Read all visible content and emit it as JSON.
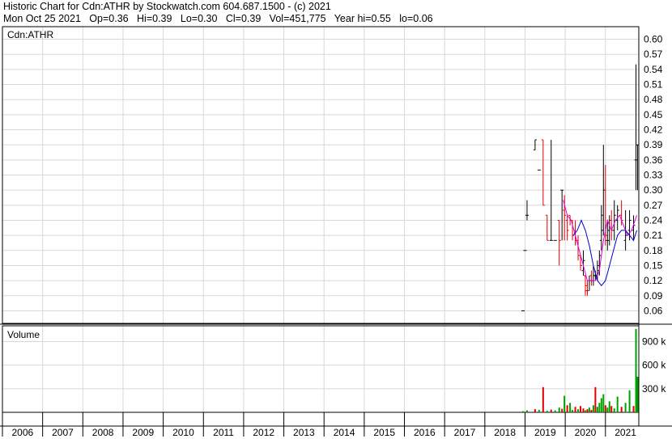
{
  "header": {
    "line1": "Historic Chart for Cdn:ATHR by Stockwatch.com 604.687.1500 - (c) 2021",
    "line2": "Mon Oct 25 2021   Op=0.36   Hi=0.39   Lo=0.30   Cl=0.39   Vol=451,775   Year hi=0.55   lo=0.06"
  },
  "price_panel": {
    "label": "Cdn:ATHR"
  },
  "volume_panel": {
    "label": "Volume"
  },
  "colors": {
    "grid": "#d8d8d8",
    "frame": "#000000",
    "up": "#000000",
    "down": "#e00000",
    "ma_short": "#e000e0",
    "ma_long": "#0000cc",
    "vol_up": "#00a000",
    "vol_down": "#e00000"
  },
  "chart_data": [
    {
      "type": "line",
      "title": "Cdn:ATHR",
      "x": [
        "2006",
        "2007",
        "2008",
        "2009",
        "2010",
        "2011",
        "2012",
        "2013",
        "2014",
        "2015",
        "2016",
        "2017",
        "2018",
        "2019",
        "2020",
        "2021"
      ],
      "y_ticks": [
        "0.60",
        "0.57",
        "0.54",
        "0.51",
        "0.48",
        "0.45",
        "0.42",
        "0.39",
        "0.36",
        "0.33",
        "0.30",
        "0.27",
        "0.24",
        "0.21",
        "0.18",
        "0.15",
        "0.12",
        "0.09",
        "0.06"
      ],
      "ylim": [
        0.035,
        0.625
      ],
      "xlim": [
        2006.0,
        2021.83
      ],
      "grid": true,
      "series": [
        {
          "values": [
            [
              2018.95,
              0.06,
              0.06,
              0.06,
              0.06
            ],
            [
              2019.0,
              0.18,
              0.18,
              0.18,
              0.18
            ],
            [
              2019.05,
              0.25,
              0.28,
              0.24,
              0.25
            ],
            [
              2019.25,
              0.38,
              0.4,
              0.38,
              0.4
            ],
            [
              2019.35,
              0.34,
              0.34,
              0.34,
              0.34
            ],
            [
              2019.45,
              0.4,
              0.4,
              0.27,
              0.27
            ],
            [
              2019.55,
              0.25,
              0.25,
              0.2,
              0.2
            ],
            [
              2019.65,
              0.2,
              0.4,
              0.2,
              0.2
            ],
            [
              2019.75,
              0.2,
              0.2,
              0.2,
              0.2
            ],
            [
              2019.85,
              0.24,
              0.24,
              0.15,
              0.2
            ],
            [
              2019.92,
              0.3,
              0.3,
              0.2,
              0.3
            ],
            [
              2019.98,
              0.26,
              0.29,
              0.2,
              0.25
            ],
            [
              2020.05,
              0.24,
              0.25,
              0.2,
              0.22
            ],
            [
              2020.12,
              0.25,
              0.25,
              0.23,
              0.24
            ],
            [
              2020.18,
              0.24,
              0.24,
              0.2,
              0.21
            ],
            [
              2020.25,
              0.22,
              0.24,
              0.19,
              0.2
            ],
            [
              2020.32,
              0.2,
              0.21,
              0.16,
              0.17
            ],
            [
              2020.38,
              0.17,
              0.17,
              0.14,
              0.15
            ],
            [
              2020.45,
              0.14,
              0.18,
              0.13,
              0.16
            ],
            [
              2020.5,
              0.13,
              0.13,
              0.09,
              0.1
            ],
            [
              2020.55,
              0.11,
              0.12,
              0.09,
              0.1
            ],
            [
              2020.6,
              0.12,
              0.13,
              0.1,
              0.12
            ],
            [
              2020.65,
              0.13,
              0.14,
              0.11,
              0.12
            ],
            [
              2020.7,
              0.12,
              0.15,
              0.11,
              0.13
            ],
            [
              2020.75,
              0.13,
              0.14,
              0.12,
              0.13
            ],
            [
              2020.8,
              0.13,
              0.16,
              0.12,
              0.15
            ],
            [
              2020.85,
              0.14,
              0.18,
              0.13,
              0.17
            ],
            [
              2020.9,
              0.2,
              0.27,
              0.18,
              0.25
            ],
            [
              2020.95,
              0.22,
              0.39,
              0.21,
              0.3
            ],
            [
              2021.0,
              0.3,
              0.35,
              0.19,
              0.21
            ],
            [
              2021.05,
              0.2,
              0.24,
              0.18,
              0.2
            ],
            [
              2021.1,
              0.22,
              0.25,
              0.19,
              0.24
            ],
            [
              2021.15,
              0.24,
              0.26,
              0.2,
              0.22
            ],
            [
              2021.22,
              0.22,
              0.28,
              0.2,
              0.25
            ],
            [
              2021.3,
              0.24,
              0.27,
              0.22,
              0.26
            ],
            [
              2021.4,
              0.25,
              0.28,
              0.23,
              0.24
            ],
            [
              2021.5,
              0.2,
              0.26,
              0.18,
              0.21
            ],
            [
              2021.6,
              0.22,
              0.26,
              0.2,
              0.24
            ],
            [
              2021.7,
              0.22,
              0.25,
              0.2,
              0.23
            ],
            [
              2021.76,
              0.36,
              0.55,
              0.3,
              0.39
            ],
            [
              2021.8,
              0.36,
              0.39,
              0.3,
              0.39
            ]
          ]
        },
        {
          "values": [
            [
              2019.95,
              0.28
            ],
            [
              2020.05,
              0.25
            ],
            [
              2020.15,
              0.24
            ],
            [
              2020.25,
              0.21
            ],
            [
              2020.35,
              0.18
            ],
            [
              2020.45,
              0.15
            ],
            [
              2020.55,
              0.12
            ],
            [
              2020.65,
              0.12
            ],
            [
              2020.75,
              0.12
            ],
            [
              2020.85,
              0.14
            ],
            [
              2020.95,
              0.2
            ],
            [
              2021.05,
              0.24
            ],
            [
              2021.15,
              0.22
            ],
            [
              2021.25,
              0.24
            ],
            [
              2021.35,
              0.25
            ],
            [
              2021.45,
              0.23
            ],
            [
              2021.55,
              0.21
            ],
            [
              2021.65,
              0.22
            ],
            [
              2021.78,
              0.25
            ]
          ]
        },
        {
          "values": [
            [
              2020.2,
              0.21
            ],
            [
              2020.3,
              0.22
            ],
            [
              2020.4,
              0.24
            ],
            [
              2020.5,
              0.22
            ],
            [
              2020.6,
              0.19
            ],
            [
              2020.7,
              0.15
            ],
            [
              2020.8,
              0.12
            ],
            [
              2020.9,
              0.11
            ],
            [
              2021.0,
              0.12
            ],
            [
              2021.1,
              0.15
            ],
            [
              2021.2,
              0.18
            ],
            [
              2021.3,
              0.21
            ],
            [
              2021.4,
              0.22
            ],
            [
              2021.5,
              0.22
            ],
            [
              2021.6,
              0.21
            ],
            [
              2021.7,
              0.2
            ],
            [
              2021.78,
              0.22
            ]
          ]
        }
      ]
    },
    {
      "type": "bar",
      "title": "Volume",
      "y_ticks": [
        "900 k",
        "600 k",
        "300 k"
      ],
      "ylim": [
        0,
        1100
      ],
      "values": [
        [
          2018.95,
          15,
          1
        ],
        [
          2019.05,
          25,
          1
        ],
        [
          2019.25,
          40,
          0
        ],
        [
          2019.35,
          30,
          1
        ],
        [
          2019.45,
          320,
          0
        ],
        [
          2019.55,
          20,
          1
        ],
        [
          2019.65,
          35,
          0
        ],
        [
          2019.75,
          25,
          1
        ],
        [
          2019.85,
          60,
          1
        ],
        [
          2019.92,
          45,
          0
        ],
        [
          2019.98,
          210,
          1
        ],
        [
          2020.05,
          90,
          0
        ],
        [
          2020.12,
          120,
          1
        ],
        [
          2020.18,
          30,
          1
        ],
        [
          2020.25,
          70,
          0
        ],
        [
          2020.32,
          40,
          1
        ],
        [
          2020.38,
          80,
          0
        ],
        [
          2020.45,
          50,
          0
        ],
        [
          2020.5,
          25,
          1
        ],
        [
          2020.55,
          40,
          0
        ],
        [
          2020.6,
          60,
          1
        ],
        [
          2020.65,
          30,
          0
        ],
        [
          2020.7,
          90,
          1
        ],
        [
          2020.75,
          320,
          0
        ],
        [
          2020.8,
          70,
          1
        ],
        [
          2020.85,
          120,
          1
        ],
        [
          2020.9,
          180,
          1
        ],
        [
          2020.95,
          230,
          1
        ],
        [
          2021.0,
          90,
          0
        ],
        [
          2021.05,
          60,
          1
        ],
        [
          2021.1,
          140,
          1
        ],
        [
          2021.15,
          80,
          0
        ],
        [
          2021.22,
          50,
          1
        ],
        [
          2021.3,
          200,
          1
        ],
        [
          2021.4,
          70,
          0
        ],
        [
          2021.5,
          120,
          1
        ],
        [
          2021.6,
          280,
          1
        ],
        [
          2021.7,
          80,
          0
        ],
        [
          2021.76,
          1060,
          1
        ],
        [
          2021.8,
          452,
          1
        ]
      ]
    }
  ]
}
